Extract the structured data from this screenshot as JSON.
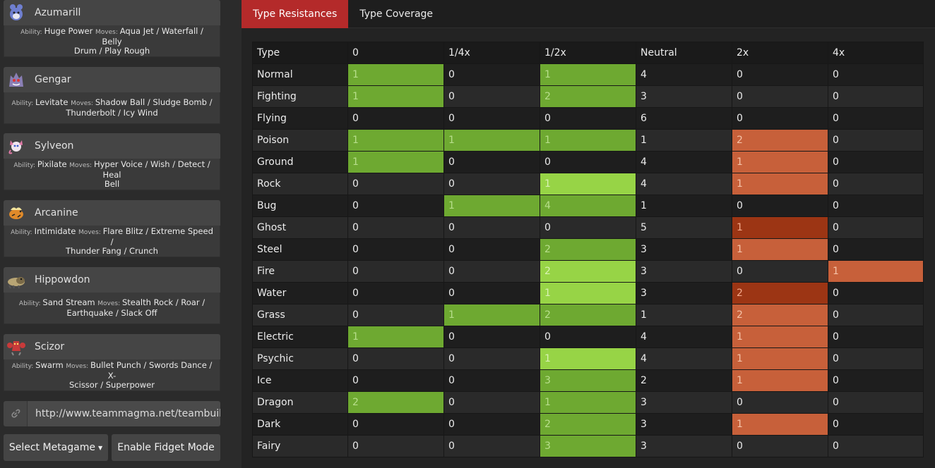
{
  "team": [
    {
      "name": "Azumarill",
      "sprite_icon": "azumarill-sprite-icon",
      "ability_label": "Ability:",
      "ability": "Huge Power",
      "moves_label": "Moves:",
      "moves_line1": "Aqua Jet / Waterfall / Belly",
      "moves_line2": "Drum / Play Rough"
    },
    {
      "name": "Gengar",
      "sprite_icon": "gengar-sprite-icon",
      "ability_label": "Ability:",
      "ability": "Levitate",
      "moves_label": "Moves:",
      "moves_line1": "Shadow Ball / Sludge Bomb /",
      "moves_line2": "Thunderbolt / Icy Wind"
    },
    {
      "name": "Sylveon",
      "sprite_icon": "sylveon-sprite-icon",
      "ability_label": "Ability:",
      "ability": "Pixilate",
      "moves_label": "Moves:",
      "moves_line1": "Hyper Voice / Wish / Detect / Heal",
      "moves_line2": "Bell"
    },
    {
      "name": "Arcanine",
      "sprite_icon": "arcanine-sprite-icon",
      "ability_label": "Ability:",
      "ability": "Intimidate",
      "moves_label": "Moves:",
      "moves_line1": "Flare Blitz / Extreme Speed /",
      "moves_line2": "Thunder Fang / Crunch"
    },
    {
      "name": "Hippowdon",
      "sprite_icon": "hippowdon-sprite-icon",
      "ability_label": "Ability:",
      "ability": "Sand Stream",
      "moves_label": "Moves:",
      "moves_line1": "Stealth Rock / Roar /",
      "moves_line2": "Earthquake / Slack Off"
    },
    {
      "name": "Scizor",
      "sprite_icon": "scizor-sprite-icon",
      "ability_label": "Ability:",
      "ability": "Swarm",
      "moves_label": "Moves:",
      "moves_line1": "Bullet Punch / Swords Dance / X-",
      "moves_line2": "Scissor / Superpower"
    }
  ],
  "link": {
    "icon": "link-icon",
    "value": "http://www.teammagma.net/teambuil"
  },
  "buttons": {
    "metagame": "Select Metagame",
    "fidget": "Enable Fidget Mode"
  },
  "tabs": [
    {
      "label": "Type Resistances",
      "active": true
    },
    {
      "label": "Type Coverage",
      "active": false
    }
  ],
  "table": {
    "headers": [
      "Type",
      "0",
      "1/4x",
      "1/2x",
      "Neutral",
      "2x",
      "4x"
    ],
    "rows": [
      {
        "type": "Normal",
        "values": [
          "1",
          "0",
          "1",
          "4",
          "0",
          "0"
        ],
        "colors": [
          "lg",
          "",
          "lg",
          "",
          "",
          ""
        ]
      },
      {
        "type": "Fighting",
        "values": [
          "1",
          "0",
          "2",
          "3",
          "0",
          "0"
        ],
        "colors": [
          "lg",
          "",
          "lg",
          "",
          "",
          ""
        ]
      },
      {
        "type": "Flying",
        "values": [
          "0",
          "0",
          "0",
          "6",
          "0",
          "0"
        ],
        "colors": [
          "",
          "",
          "",
          "",
          "",
          ""
        ]
      },
      {
        "type": "Poison",
        "values": [
          "1",
          "1",
          "1",
          "1",
          "2",
          "0"
        ],
        "colors": [
          "lg",
          "lg",
          "lg",
          "",
          "or",
          ""
        ]
      },
      {
        "type": "Ground",
        "values": [
          "1",
          "0",
          "0",
          "4",
          "1",
          "0"
        ],
        "colors": [
          "lg",
          "",
          "",
          "",
          "or",
          ""
        ]
      },
      {
        "type": "Rock",
        "values": [
          "0",
          "0",
          "1",
          "4",
          "1",
          "0"
        ],
        "colors": [
          "",
          "",
          "lg2",
          "",
          "or",
          ""
        ]
      },
      {
        "type": "Bug",
        "values": [
          "0",
          "1",
          "4",
          "1",
          "0",
          "0"
        ],
        "colors": [
          "",
          "lg",
          "lg",
          "",
          "",
          ""
        ]
      },
      {
        "type": "Ghost",
        "values": [
          "0",
          "0",
          "0",
          "5",
          "1",
          "0"
        ],
        "colors": [
          "",
          "",
          "",
          "",
          "or2",
          ""
        ]
      },
      {
        "type": "Steel",
        "values": [
          "0",
          "0",
          "2",
          "3",
          "1",
          "0"
        ],
        "colors": [
          "",
          "",
          "lg",
          "",
          "or",
          ""
        ]
      },
      {
        "type": "Fire",
        "values": [
          "0",
          "0",
          "2",
          "3",
          "0",
          "1"
        ],
        "colors": [
          "",
          "",
          "lg2",
          "",
          "",
          "or"
        ]
      },
      {
        "type": "Water",
        "values": [
          "0",
          "0",
          "1",
          "3",
          "2",
          "0"
        ],
        "colors": [
          "",
          "",
          "lg2",
          "",
          "or2",
          ""
        ]
      },
      {
        "type": "Grass",
        "values": [
          "0",
          "1",
          "2",
          "1",
          "2",
          "0"
        ],
        "colors": [
          "",
          "lg",
          "lg",
          "",
          "or",
          ""
        ]
      },
      {
        "type": "Electric",
        "values": [
          "1",
          "0",
          "0",
          "4",
          "1",
          "0"
        ],
        "colors": [
          "lg",
          "",
          "",
          "",
          "or",
          ""
        ]
      },
      {
        "type": "Psychic",
        "values": [
          "0",
          "0",
          "1",
          "4",
          "1",
          "0"
        ],
        "colors": [
          "",
          "",
          "lg2",
          "",
          "or",
          ""
        ]
      },
      {
        "type": "Ice",
        "values": [
          "0",
          "0",
          "3",
          "2",
          "1",
          "0"
        ],
        "colors": [
          "",
          "",
          "lg",
          "",
          "or",
          ""
        ]
      },
      {
        "type": "Dragon",
        "values": [
          "2",
          "0",
          "1",
          "3",
          "0",
          "0"
        ],
        "colors": [
          "lg",
          "",
          "lg",
          "",
          "",
          ""
        ]
      },
      {
        "type": "Dark",
        "values": [
          "0",
          "0",
          "2",
          "3",
          "1",
          "0"
        ],
        "colors": [
          "",
          "",
          "lg",
          "",
          "or",
          ""
        ]
      },
      {
        "type": "Fairy",
        "values": [
          "0",
          "0",
          "3",
          "3",
          "0",
          "0"
        ],
        "colors": [
          "",
          "",
          "lg",
          "",
          "",
          ""
        ]
      }
    ]
  },
  "colors": {
    "tab_active": "#b42a2a",
    "resist": "#6ea931",
    "resist_light": "#97d446",
    "weak": "#c7603a",
    "weak_dark": "#9c3514"
  }
}
